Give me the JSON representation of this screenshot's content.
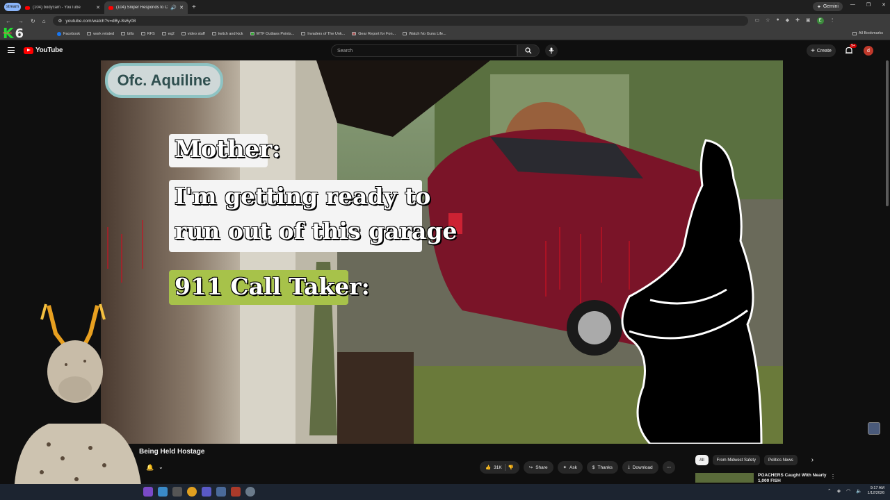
{
  "browser": {
    "stream_badge": "stream",
    "tabs": [
      {
        "label": "(104) bodycam - YouTube",
        "active": false
      },
      {
        "label": "(104) Sniper Responds to C",
        "active": true
      }
    ],
    "gemini_label": "Gemini",
    "url": "youtube.com/watch?v=dBy-8s6y08",
    "user_initial": "E",
    "bookmarks": [
      "Facebook",
      "work related",
      "bills",
      "RFS",
      "eq2",
      "video stuff",
      "twitch and kick",
      "WTF Outlaws Points...",
      "Invaders of The Unk...",
      "Gear Report for Fon...",
      "Watch No Guns Life..."
    ],
    "all_bookmarks": "All Bookmarks"
  },
  "overlay_logo": {
    "letter": "K",
    "number": "6",
    "music": "music"
  },
  "youtube": {
    "logo_text": "YouTube",
    "search_placeholder": "Search",
    "create_label": "Create",
    "notif_count": "9+",
    "user_initial": "d"
  },
  "video": {
    "officer_label": "Ofc. Aquiline",
    "speaker1": "Mother:",
    "line1a": "I'm getting ready to",
    "line1b": "run out of this garage",
    "speaker2": "911 Call Taker:",
    "title_partial": "Being Held Hostage"
  },
  "actions": {
    "likes": "31K",
    "share": "Share",
    "ask": "Ask",
    "thanks": "Thanks",
    "download": "Download"
  },
  "chips": [
    "All",
    "From Midwest Safety",
    "Politics News"
  ],
  "recommendation": {
    "title": "POACHERS Caught With Nearly 1,000 FISH"
  },
  "taskbar": {
    "time": "9:17 AM",
    "date": "1/12/2026"
  }
}
